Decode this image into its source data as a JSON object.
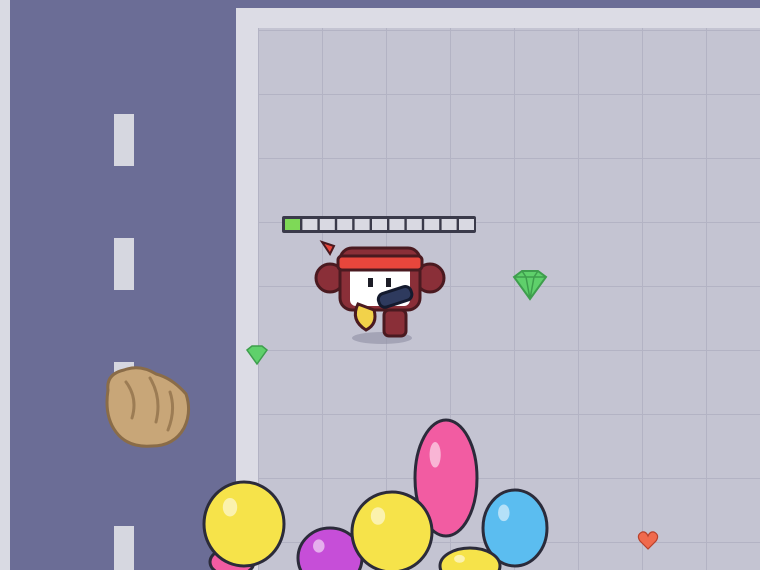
{
  "game": {
    "player": {
      "xp_bar": {
        "segments_total": 11,
        "segments_filled": 1
      }
    },
    "colors": {
      "road": "#6b6d96",
      "road_edge": "#d9dae3",
      "lane_marking": "#d6d7e0",
      "floor": "#c4c4d2",
      "floor_grid": "#b6b6c6",
      "wall": "#dcdce5",
      "xp_fill": "#7ed957",
      "gem": "#5fd06b",
      "headband": "#e8463c",
      "player_body": "#8a2f38",
      "rock": "#c8a678",
      "heart": "#f06a4d",
      "balloon_yellow": "#f6e34a",
      "balloon_pink": "#f25ca2",
      "balloon_blue": "#5bbdf0",
      "balloon_purple": "#c64ed8"
    },
    "pickups": [
      {
        "type": "gem",
        "icon": "gem-icon"
      },
      {
        "type": "gem",
        "icon": "gem-icon"
      },
      {
        "type": "heart",
        "icon": "heart-icon"
      }
    ],
    "hazards": [
      {
        "type": "rock",
        "icon": "rock-icon"
      }
    ],
    "enemies": [
      {
        "type": "balloon",
        "color": "yellow"
      },
      {
        "type": "balloon",
        "color": "purple"
      },
      {
        "type": "balloon",
        "color": "yellow"
      },
      {
        "type": "balloon",
        "color": "pink"
      },
      {
        "type": "balloon",
        "color": "blue"
      },
      {
        "type": "balloon",
        "color": "yellow"
      },
      {
        "type": "balloon",
        "color": "pink"
      }
    ]
  }
}
